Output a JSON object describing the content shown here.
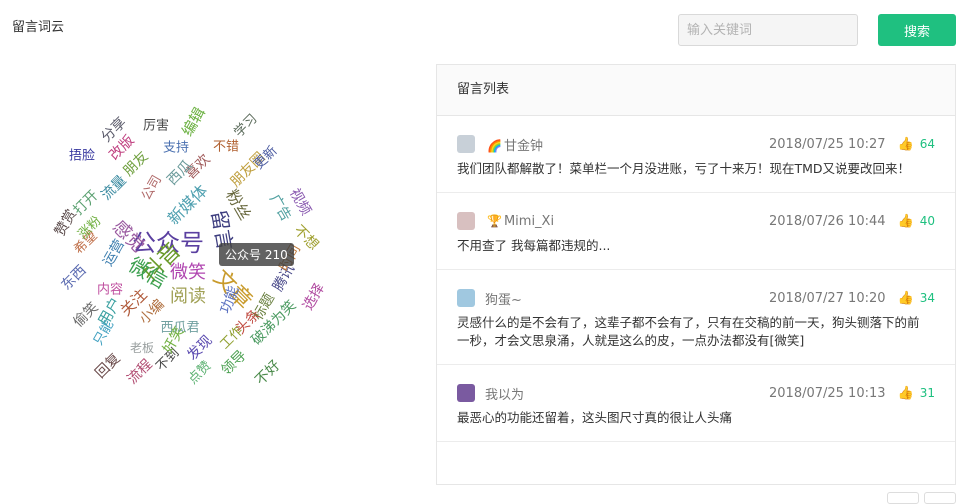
{
  "header": {
    "title": "留言词云",
    "search_placeholder": "输入关键词",
    "search_label": "搜索"
  },
  "colors": {
    "accent": "#1fc080",
    "border": "#e6e6e6"
  },
  "wordcloud": {
    "tooltip": "公众号 210",
    "words": [
      {
        "text": "公众号",
        "color": "#5a3fa0"
      },
      {
        "text": "抖音",
        "color": "#6a9a2a"
      },
      {
        "text": "文章",
        "color": "#c89a2a"
      },
      {
        "text": "微信",
        "color": "#3ca050"
      },
      {
        "text": "微笑",
        "color": "#b045b0"
      },
      {
        "text": "阅读",
        "color": "#a0a055"
      },
      {
        "text": "留言",
        "color": "#3f3f80"
      },
      {
        "text": "感觉",
        "color": "#9a5aa0"
      },
      {
        "text": "新媒体",
        "color": "#4fa0b0"
      },
      {
        "text": "粉丝",
        "color": "#6a6a40"
      },
      {
        "text": "内容",
        "color": "#c050a0"
      },
      {
        "text": "运营",
        "color": "#4080b0"
      },
      {
        "text": "关注",
        "color": "#b05a3a"
      },
      {
        "text": "用户",
        "color": "#3aa0a0"
      },
      {
        "text": "小编",
        "color": "#b07040"
      },
      {
        "text": "西瓜君",
        "color": "#70a0a0"
      },
      {
        "text": "功能",
        "color": "#5a70c0"
      },
      {
        "text": "标题",
        "color": "#6a8040"
      },
      {
        "text": "头条",
        "color": "#c04a40"
      },
      {
        "text": "工作",
        "color": "#90a030"
      },
      {
        "text": "破涕为笑",
        "color": "#4a9a60"
      },
      {
        "text": "选择",
        "color": "#b04aa0"
      },
      {
        "text": "腾讯",
        "color": "#4a4a8a"
      },
      {
        "text": "时间",
        "color": "#c07a3a"
      },
      {
        "text": "流量",
        "color": "#3a8aa0"
      },
      {
        "text": "不想",
        "color": "#a0a030"
      },
      {
        "text": "视频",
        "color": "#8a5ab0"
      },
      {
        "text": "广告",
        "color": "#50a0a0"
      },
      {
        "text": "朋友圈",
        "color": "#c0a040"
      },
      {
        "text": "更新",
        "color": "#4a5aa0"
      },
      {
        "text": "喜欢",
        "color": "#a05a5a"
      },
      {
        "text": "西瓜",
        "color": "#6a9a9a"
      },
      {
        "text": "公司",
        "color": "#b06a6a"
      },
      {
        "text": "朋友",
        "color": "#70a040"
      },
      {
        "text": "改版",
        "color": "#c04080"
      },
      {
        "text": "分享",
        "color": "#5a5a6a"
      },
      {
        "text": "厉害",
        "color": "#4a4a4a"
      },
      {
        "text": "编辑",
        "color": "#6ab040"
      },
      {
        "text": "学习",
        "color": "#5a6a5a"
      },
      {
        "text": "支持",
        "color": "#4a70b0"
      },
      {
        "text": "不错",
        "color": "#b06030"
      },
      {
        "text": "捂脸",
        "color": "#3a3aa0"
      },
      {
        "text": "打开",
        "color": "#5aa070"
      },
      {
        "text": "赞赏",
        "color": "#5a4a4a"
      },
      {
        "text": "希望",
        "color": "#c0704a"
      },
      {
        "text": "涨粉",
        "color": "#70b040"
      },
      {
        "text": "东西",
        "color": "#5a6ab0"
      },
      {
        "text": "偷笑",
        "color": "#6a6a6a"
      },
      {
        "text": "只能",
        "color": "#40a0c0"
      },
      {
        "text": "老板",
        "color": "#9aa0a0"
      },
      {
        "text": "回复",
        "color": "#6a4a4a"
      },
      {
        "text": "流程",
        "color": "#b04a70"
      },
      {
        "text": "不到",
        "color": "#4a4a4a"
      },
      {
        "text": "点赞",
        "color": "#5ab070"
      },
      {
        "text": "领导",
        "color": "#4aa050"
      },
      {
        "text": "发现",
        "color": "#5a4ab0"
      },
      {
        "text": "奸笑",
        "color": "#70b040"
      },
      {
        "text": "不好",
        "color": "#4a8a4a"
      }
    ]
  },
  "message_panel": {
    "title": "留言列表",
    "items": [
      {
        "author": "甘金钟",
        "author_emoji": "🌈",
        "date": "2018/07/25 10:27",
        "likes": "64",
        "content": "我们团队都解散了！菜单栏一个月没进账，亏了十来万！现在TMD又说要改回来！",
        "avatar_color": "#c8d0d8"
      },
      {
        "author": "Mimi_Xi",
        "author_emoji": "🏆",
        "date": "2018/07/26 10:44",
        "likes": "40",
        "content": "不用查了 我每篇都违规的...",
        "avatar_color": "#d8c0c0"
      },
      {
        "author": "狗蛋~",
        "author_emoji": "",
        "date": "2018/07/27 10:20",
        "likes": "34",
        "content": "灵感什么的是不会有了，这辈子都不会有了，只有在交稿的前一天，狗头铡落下的前一秒，才会文思泉涌，人就是这么的皮，一点办法都没有[微笑]",
        "avatar_color": "#a0c8e0"
      },
      {
        "author": "我以为",
        "author_emoji": "",
        "date": "2018/07/25 10:13",
        "likes": "31",
        "content": "最恶心的功能还留着，这头图尺寸真的很让人头痛",
        "avatar_color": "#7a5aa0"
      }
    ]
  }
}
